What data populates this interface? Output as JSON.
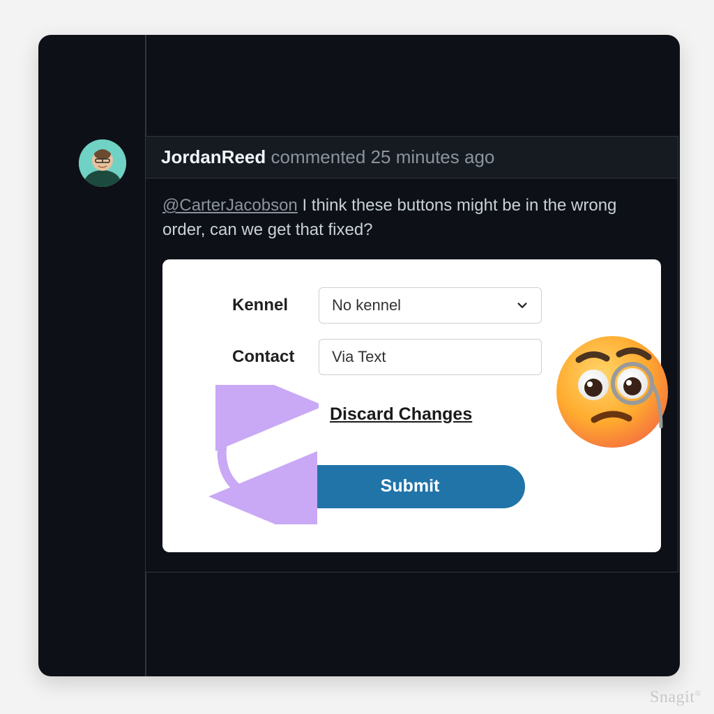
{
  "comment": {
    "author": "JordanReed",
    "action_text": "commented",
    "time_ago": "25 minutes ago",
    "mention": "@CarterJacobson",
    "body_text": "I think these buttons might be in the wrong order, can we get that fixed?"
  },
  "form": {
    "kennel_label": "Kennel",
    "kennel_value": "No kennel",
    "contact_label": "Contact",
    "contact_value": "Via Text",
    "discard_label": "Discard Changes",
    "submit_label": "Submit"
  },
  "annotations": {
    "swap_arrow": "swap-order-arrow",
    "emoji_name": "face-with-monocle"
  },
  "watermark": "Snagit"
}
